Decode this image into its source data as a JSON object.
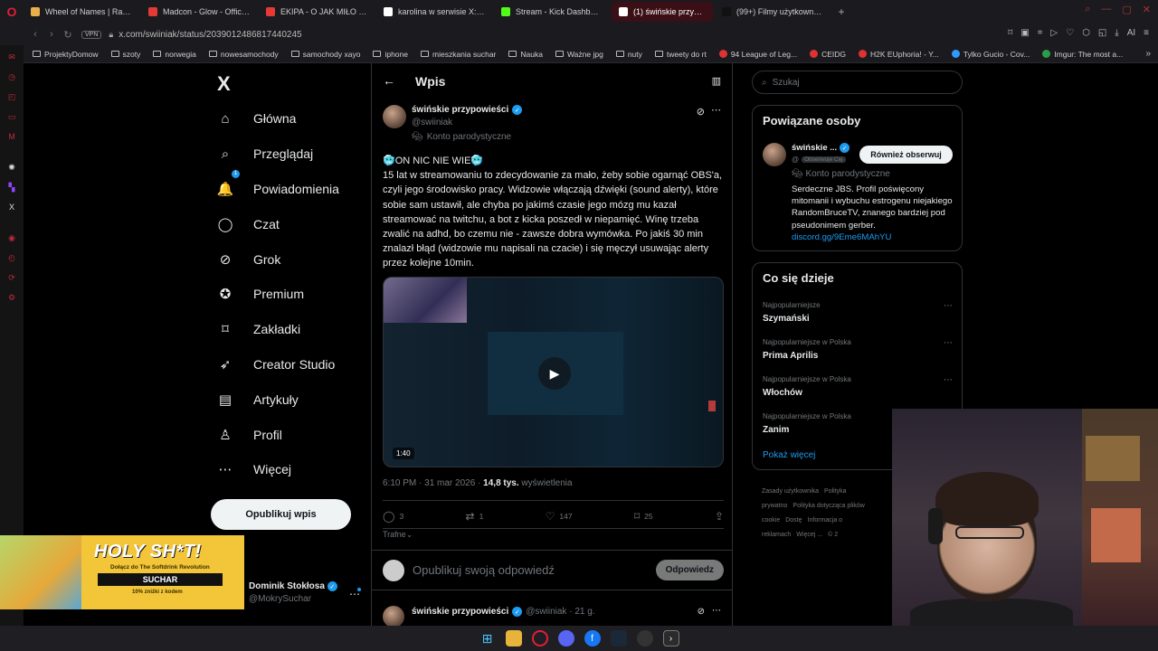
{
  "browser": {
    "tabs": [
      {
        "label": "Wheel of Names | Random",
        "color": "#e8b04a"
      },
      {
        "label": "Madcon - Glow - Official I",
        "color": "#e53935"
      },
      {
        "label": "EKIPA - O JAK MIŁO (Wyj",
        "color": "#e53935"
      },
      {
        "label": "karolina w serwisie X: „wi",
        "color": "#ffffff"
      },
      {
        "label": "Stream - Kick Dashboard",
        "color": "#53fc18"
      },
      {
        "label": "(1) świńskie przypowieści",
        "color": "#ffffff",
        "active": true
      },
      {
        "label": "(99+) Filmy użytkownika a",
        "color": "#111111"
      }
    ],
    "vpn_label": "VPN",
    "url": "x.com/swiiniak/status/2039012486817440245",
    "ai_label": "AI",
    "bookmarks": [
      {
        "label": "ProjektyDomow",
        "icon": "folder"
      },
      {
        "label": "szoty",
        "icon": "folder"
      },
      {
        "label": "norwegia",
        "icon": "folder"
      },
      {
        "label": "nowesamochody",
        "icon": "folder"
      },
      {
        "label": "samochody xayo",
        "icon": "folder"
      },
      {
        "label": "iphone",
        "icon": "folder"
      },
      {
        "label": "mieszkania suchar",
        "icon": "folder"
      },
      {
        "label": "Nauka",
        "icon": "folder"
      },
      {
        "label": "Ważne jpg",
        "icon": "folder"
      },
      {
        "label": "nuty",
        "icon": "folder"
      },
      {
        "label": "tweety do rt",
        "icon": "folder"
      },
      {
        "label": "94 League of Leg...",
        "icon": "dot-red"
      },
      {
        "label": "CEIDG",
        "icon": "dot-red"
      },
      {
        "label": "H2K EUphoria! - Y...",
        "icon": "dot-red"
      },
      {
        "label": "Tylko Gucio - Cov...",
        "icon": "dot-blue"
      },
      {
        "label": "Imgur: The most a...",
        "icon": "dot-green"
      }
    ]
  },
  "x_nav": {
    "logo": "X",
    "items": [
      {
        "label": "Główna",
        "icon": "home-icon",
        "glyph": "⌂"
      },
      {
        "label": "Przeglądaj",
        "icon": "search-icon",
        "glyph": "⌕"
      },
      {
        "label": "Powiadomienia",
        "icon": "bell-icon",
        "glyph": "🔔",
        "badge": "1"
      },
      {
        "label": "Czat",
        "icon": "chat-icon",
        "glyph": "◯"
      },
      {
        "label": "Grok",
        "icon": "grok-icon",
        "glyph": "⊘"
      },
      {
        "label": "Premium",
        "icon": "premium-icon",
        "glyph": "✪"
      },
      {
        "label": "Zakładki",
        "icon": "bookmark-icon",
        "glyph": "⌑"
      },
      {
        "label": "Creator Studio",
        "icon": "rocket-icon",
        "glyph": "➶"
      },
      {
        "label": "Artykuły",
        "icon": "article-icon",
        "glyph": "▤"
      },
      {
        "label": "Profil",
        "icon": "profile-icon",
        "glyph": "♙"
      },
      {
        "label": "Więcej",
        "icon": "more-icon",
        "glyph": "⋯"
      }
    ],
    "post_button": "Opublikuj wpis",
    "account": {
      "name": "Dominik Stokłosa",
      "handle": "@MokrySuchar"
    }
  },
  "ad": {
    "title": "HOLY SH*T!",
    "subtitle": "Dołącz do The Softdrink Revolution",
    "code": "SUCHAR",
    "discount": "10% zniżki z kodem"
  },
  "post_header": {
    "title": "Wpis"
  },
  "post": {
    "author": "świńskie przypowieści",
    "handle": "@swiiniak",
    "badge": "Konto parodystyczne",
    "lines": [
      "🥶ON NIC NIE WIE🥶",
      "15 lat w streamowaniu to zdecydowanie za mało, żeby sobie ogarnąć OBS'a, czyli jego środowisko pracy. Widzowie włączają dźwięki (sound alerty), które sobie sam ustawił, ale chyba po jakimś czasie jego mózg mu kazał streamować na twitchu, a bot z kicka poszedł w niepamięć. Winę trzeba zwalić na adhd, bo czemu nie - zawsze dobra wymówka. Po jakiś 30 min znalazł błąd (widzowie mu napisali na czacie) i się męczył usuwając alerty przez kolejne 10min."
    ],
    "video_duration": "1:40",
    "timestamp": "6:10 PM · 31 mar 2026 · ",
    "views_count": "14,8 tys.",
    "views_label": " wyświetlenia",
    "stats": {
      "replies": "3",
      "reposts": "1",
      "likes": "147",
      "bookmarks": "25"
    },
    "sort_label": "Trafne",
    "reply_placeholder": "Opublikuj swoją odpowiedź",
    "reply_button": "Odpowiedz",
    "next_reply": {
      "author": "świńskie przypowieści",
      "handle": "@swiiniak · 21 g."
    }
  },
  "sidebar": {
    "search_placeholder": "Szukaj",
    "related_title": "Powiązane osoby",
    "related": {
      "name": "świńskie ...",
      "handle": "@",
      "follows_tag": "Obserwuje Cię",
      "follow_button": "Również obserwuj",
      "badge": "Konto parodystyczne",
      "bio": "Serdeczne JBS. Profil poświęcony mitomanii i wybuchu estrogenu niejakiego RandomBruceTV, znanego bardziej pod pseudonimem gerber.",
      "link": "discord.gg/9Eme6MAhYU"
    },
    "trends_title": "Co się dzieje",
    "trends": [
      {
        "context": "Najpopularniejsze",
        "name": "Szymański"
      },
      {
        "context": "Najpopularniejsze w Polska",
        "name": "Prima Aprilis"
      },
      {
        "context": "Najpopularniejsze w Polska",
        "name": "Włochów"
      },
      {
        "context": "Najpopularniejsze w Polska",
        "name": "Zanim"
      }
    ],
    "show_more": "Pokaż więcej",
    "footer": [
      "Zasady użytkownika",
      "Polityka prywatno",
      "Polityka dotycząca plików cookie",
      "Dostę",
      "Informacja o reklamach",
      "Więcej ...",
      "© 2"
    ]
  }
}
